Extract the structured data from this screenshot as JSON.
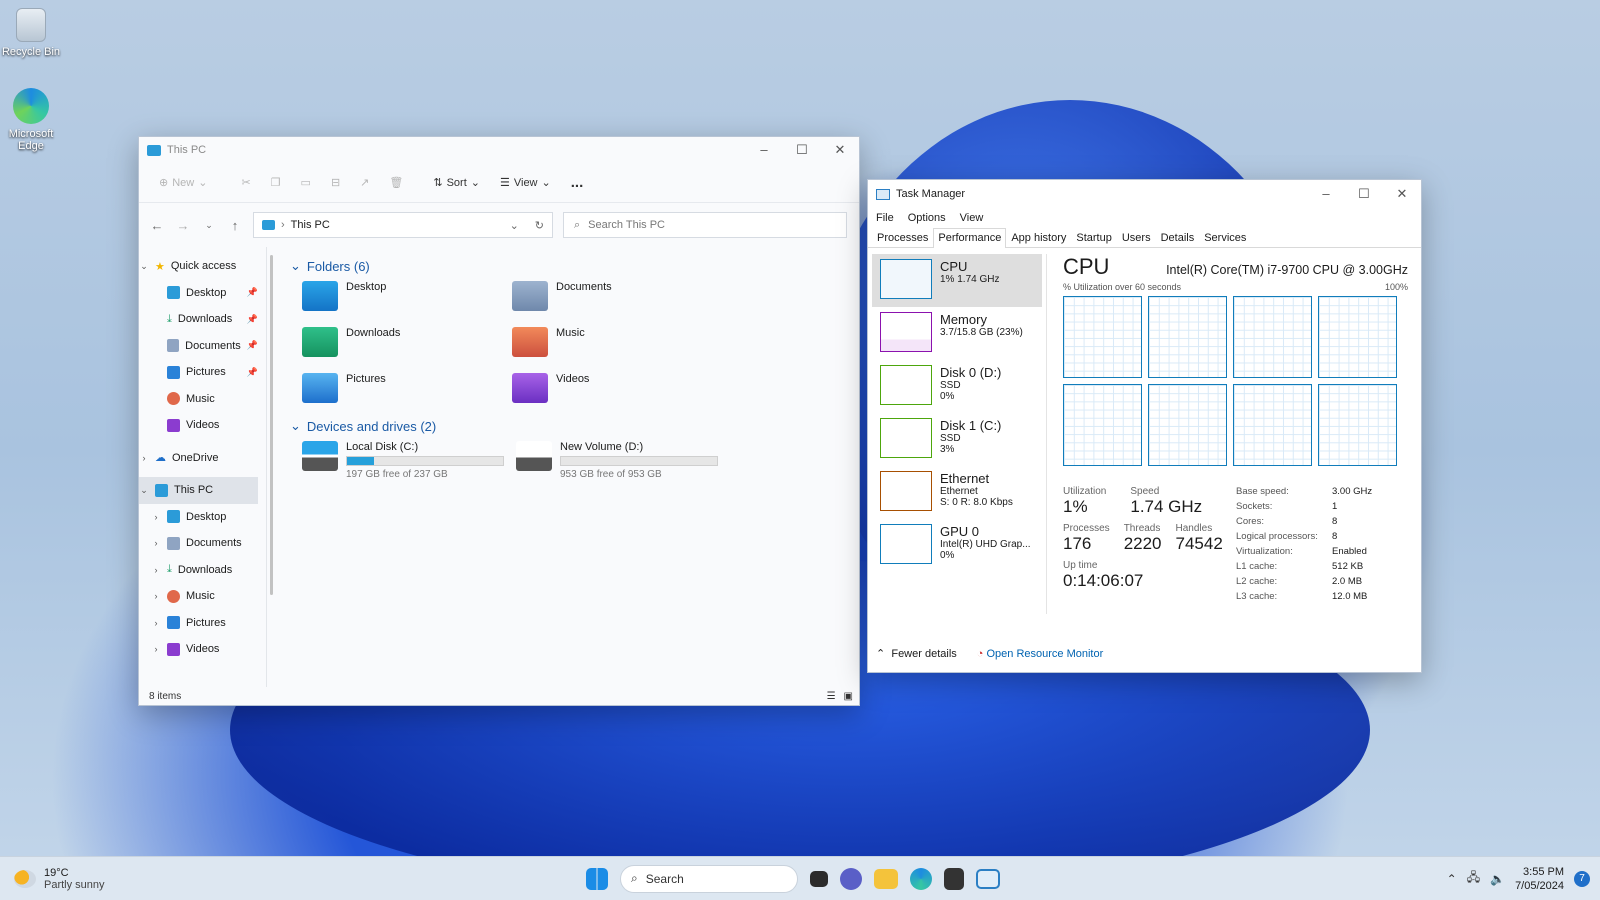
{
  "desktop": {
    "icons": [
      {
        "label": "Recycle Bin"
      },
      {
        "label": "Microsoft Edge"
      }
    ]
  },
  "explorer": {
    "title": "This PC",
    "toolbar": {
      "new": "New",
      "sort": "Sort",
      "view": "View",
      "more": "..."
    },
    "address": {
      "crumb": "This PC",
      "search_placeholder": "Search This PC"
    },
    "nav": {
      "quick_access": "Quick access",
      "quick_items": [
        "Desktop",
        "Downloads",
        "Documents",
        "Pictures",
        "Music",
        "Videos"
      ],
      "onedrive": "OneDrive",
      "this_pc": "This PC",
      "pc_items": [
        "Desktop",
        "Documents",
        "Downloads",
        "Music",
        "Pictures",
        "Videos"
      ]
    },
    "folders_header": "Folders (6)",
    "folders": [
      "Desktop",
      "Documents",
      "Downloads",
      "Music",
      "Pictures",
      "Videos"
    ],
    "drives_header": "Devices and drives (2)",
    "drives": [
      {
        "name": "Local Disk (C:)",
        "free": "197 GB free of 237 GB",
        "used_fraction": 0.17
      },
      {
        "name": "New Volume (D:)",
        "free": "953 GB free of 953 GB",
        "used_fraction": 0.0
      }
    ],
    "status": "8 items"
  },
  "taskmgr": {
    "title": "Task Manager",
    "menu": [
      "File",
      "Options",
      "View"
    ],
    "tabs": [
      "Processes",
      "Performance",
      "App history",
      "Startup",
      "Users",
      "Details",
      "Services"
    ],
    "active_tab": "Performance",
    "resources": [
      {
        "name": "CPU",
        "sub1": "1%  1.74 GHz",
        "sub2": "",
        "color": "#117dbb"
      },
      {
        "name": "Memory",
        "sub1": "3.7/15.8 GB (23%)",
        "sub2": "",
        "color": "#8b12ae"
      },
      {
        "name": "Disk 0 (D:)",
        "sub1": "SSD",
        "sub2": "0%",
        "color": "#4da60c"
      },
      {
        "name": "Disk 1 (C:)",
        "sub1": "SSD",
        "sub2": "3%",
        "color": "#4da60c"
      },
      {
        "name": "Ethernet",
        "sub1": "Ethernet",
        "sub2": "S: 0 R: 8.0 Kbps",
        "color": "#a74f01"
      },
      {
        "name": "GPU 0",
        "sub1": "Intel(R) UHD Grap...",
        "sub2": "0%",
        "color": "#117dbb"
      }
    ],
    "cpu": {
      "heading": "CPU",
      "model": "Intel(R) Core(TM) i7-9700 CPU @ 3.00GHz",
      "graph_label": "% Utilization over 60 seconds",
      "graph_max": "100%",
      "utilization_label": "Utilization",
      "utilization": "1%",
      "speed_label": "Speed",
      "speed": "1.74 GHz",
      "processes_label": "Processes",
      "processes": "176",
      "threads_label": "Threads",
      "threads": "2220",
      "handles_label": "Handles",
      "handles": "74542",
      "uptime_label": "Up time",
      "uptime": "0:14:06:07",
      "specs": [
        [
          "Base speed:",
          "3.00 GHz"
        ],
        [
          "Sockets:",
          "1"
        ],
        [
          "Cores:",
          "8"
        ],
        [
          "Logical processors:",
          "8"
        ],
        [
          "Virtualization:",
          "Enabled"
        ],
        [
          "L1 cache:",
          "512 KB"
        ],
        [
          "L2 cache:",
          "2.0 MB"
        ],
        [
          "L3 cache:",
          "12.0 MB"
        ]
      ]
    },
    "footer": {
      "fewer": "Fewer details",
      "monitor": "Open Resource Monitor"
    }
  },
  "taskbar": {
    "weather_temp": "19°C",
    "weather_desc": "Partly sunny",
    "search": "Search",
    "time": "3:55 PM",
    "date": "7/05/2024",
    "badge": "7"
  }
}
